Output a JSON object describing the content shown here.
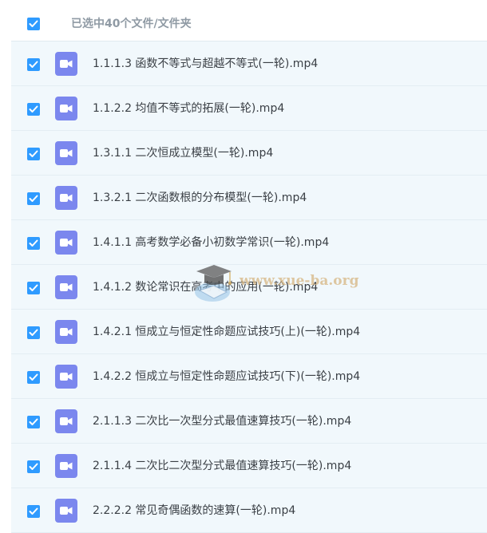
{
  "header": {
    "selected_label": "已选中40个文件/文件夹",
    "checked": true
  },
  "file_icon": "video-file-icon",
  "check_icon": "checkmark-icon",
  "colors": {
    "checkbox": "#2f9bff",
    "file_icon": "#7b87ee",
    "row_bg": "#f1f8fc",
    "header_text": "#8f9aa4",
    "row_text": "#3a3f45"
  },
  "files": [
    {
      "name": "1.1.1.3 函数不等式与超越不等式(一轮).mp4",
      "checked": true
    },
    {
      "name": "1.1.2.2 均值不等式的拓展(一轮).mp4",
      "checked": true
    },
    {
      "name": "1.3.1.1 二次恒成立模型(一轮).mp4",
      "checked": true
    },
    {
      "name": "1.3.2.1 二次函数根的分布模型(一轮).mp4",
      "checked": true
    },
    {
      "name": "1.4.1.1 高考数学必备小初数学常识(一轮).mp4",
      "checked": true
    },
    {
      "name": "1.4.1.2 数论常识在高考中的应用(一轮).mp4",
      "checked": true
    },
    {
      "name": "1.4.2.1 恒成立与恒定性命题应试技巧(上)(一轮).mp4",
      "checked": true
    },
    {
      "name": "1.4.2.2 恒成立与恒定性命题应试技巧(下)(一轮).mp4",
      "checked": true
    },
    {
      "name": "2.1.1.3 二次比一次型分式最值速算技巧(一轮).mp4",
      "checked": true
    },
    {
      "name": "2.1.1.4 二次比二次型分式最值速算技巧(一轮).mp4",
      "checked": true
    },
    {
      "name": "2.2.2.2 常见奇偶函数的速算(一轮).mp4",
      "checked": true
    }
  ],
  "watermark": {
    "text": "www.xue-ba.org",
    "icon": "graduation-cap-icon"
  }
}
